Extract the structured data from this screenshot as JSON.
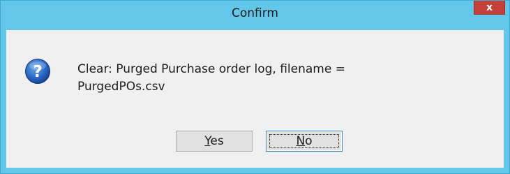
{
  "window": {
    "title": "Confirm",
    "close_label": "x"
  },
  "dialog": {
    "icon": "question-icon",
    "icon_glyph": "?",
    "message_line1": "Clear: Purged Purchase order log,  filename =",
    "message_line2": "PurgedPOs.csv"
  },
  "buttons": {
    "yes": {
      "mnemonic": "Y",
      "rest": "es"
    },
    "no": {
      "mnemonic": "N",
      "rest": "o"
    }
  },
  "colors": {
    "frame": "#62c7e9",
    "close": "#c6403a",
    "client": "#f0f0f0",
    "icon": "#1f5fb8"
  }
}
